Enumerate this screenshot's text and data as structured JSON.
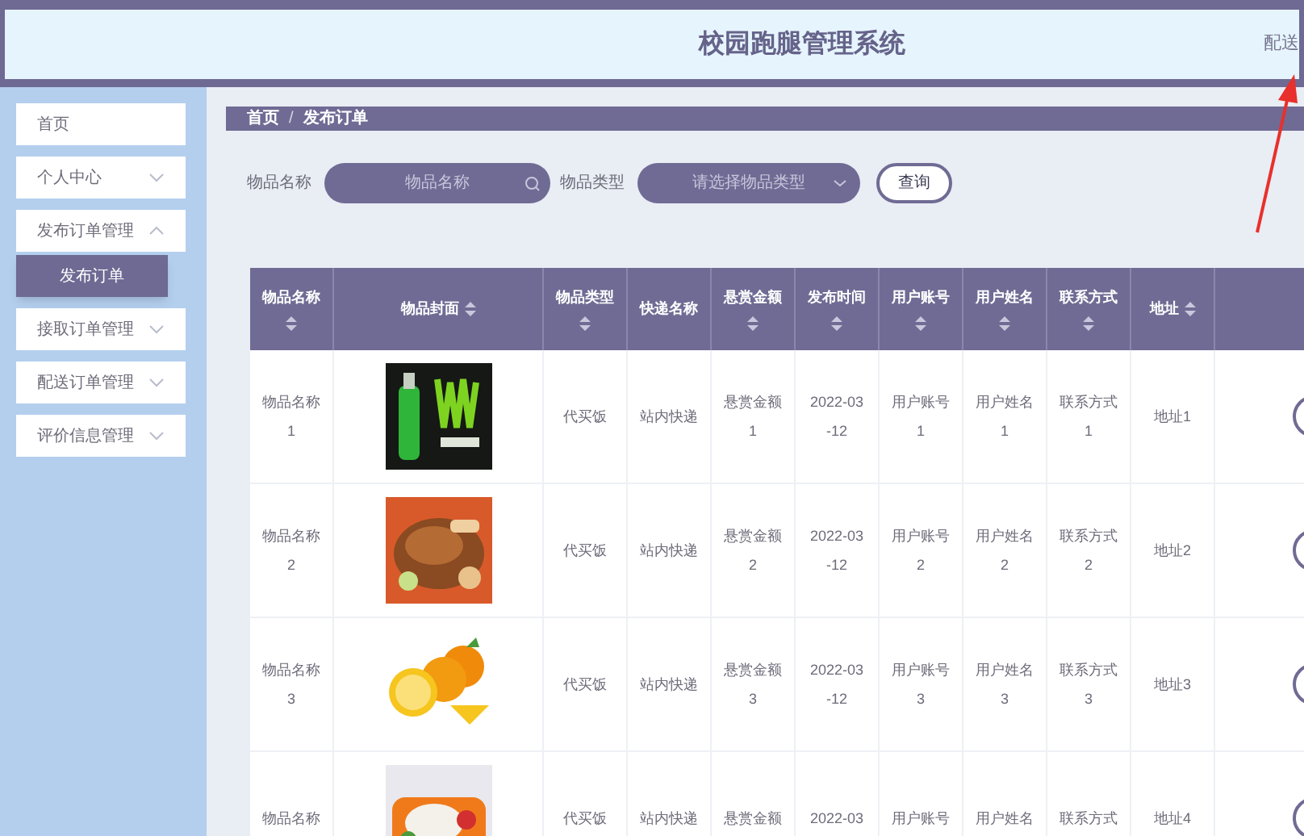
{
  "header": {
    "title": "校园跑腿管理系统",
    "user": "配送"
  },
  "sidebar": {
    "items": [
      {
        "label": "首页",
        "kind": "link"
      },
      {
        "label": "个人中心",
        "kind": "menu",
        "expanded": false
      },
      {
        "label": "发布订单管理",
        "kind": "menu",
        "expanded": true,
        "children": [
          {
            "label": "发布订单",
            "selected": true
          }
        ]
      },
      {
        "label": "接取订单管理",
        "kind": "menu",
        "expanded": false
      },
      {
        "label": "配送订单管理",
        "kind": "menu",
        "expanded": false
      },
      {
        "label": "评价信息管理",
        "kind": "menu",
        "expanded": false
      }
    ]
  },
  "breadcrumb": {
    "items": [
      "首页",
      "发布订单"
    ],
    "separator": "/"
  },
  "search": {
    "name_label": "物品名称",
    "name_placeholder": "物品名称",
    "type_label": "物品类型",
    "type_placeholder": "请选择物品类型",
    "button": "查询"
  },
  "table": {
    "columns": [
      {
        "label": "物品名称",
        "sortable": true
      },
      {
        "label": "物品封面",
        "sortable": true
      },
      {
        "label": "物品类型",
        "sortable": true
      },
      {
        "label": "快递名称",
        "sortable": false
      },
      {
        "label": "悬赏金额",
        "sortable": true
      },
      {
        "label": "发布时间",
        "sortable": true
      },
      {
        "label": "用户账号",
        "sortable": true
      },
      {
        "label": "用户姓名",
        "sortable": true
      },
      {
        "label": "联系方式",
        "sortable": true
      },
      {
        "label": "地址",
        "sortable": true
      }
    ],
    "rows": [
      {
        "cells": [
          [
            "物品名称",
            "1"
          ],
          null,
          [
            "代买饭"
          ],
          [
            "站内快递"
          ],
          [
            "悬赏金额",
            "1"
          ],
          [
            "2022-03",
            "-12"
          ],
          [
            "用户账号",
            "1"
          ],
          [
            "用户姓名",
            "1"
          ],
          [
            "联系方式",
            "1"
          ],
          [
            "地址1"
          ]
        ]
      },
      {
        "cells": [
          [
            "物品名称",
            "2"
          ],
          null,
          [
            "代买饭"
          ],
          [
            "站内快递"
          ],
          [
            "悬赏金额",
            "2"
          ],
          [
            "2022-03",
            "-12"
          ],
          [
            "用户账号",
            "2"
          ],
          [
            "用户姓名",
            "2"
          ],
          [
            "联系方式",
            "2"
          ],
          [
            "地址2"
          ]
        ]
      },
      {
        "cells": [
          [
            "物品名称",
            "3"
          ],
          null,
          [
            "代买饭"
          ],
          [
            "站内快递"
          ],
          [
            "悬赏金额",
            "3"
          ],
          [
            "2022-03",
            "-12"
          ],
          [
            "用户账号",
            "3"
          ],
          [
            "用户姓名",
            "3"
          ],
          [
            "联系方式",
            "3"
          ],
          [
            "地址3"
          ]
        ]
      },
      {
        "cells": [
          [
            "物品名称"
          ],
          null,
          [
            "代买饭"
          ],
          [
            "站内快递"
          ],
          [
            "悬赏金额"
          ],
          [
            "2022-03"
          ],
          [
            "用户账号"
          ],
          [
            "用户姓名"
          ],
          [
            "联系方式"
          ],
          [
            "地址4"
          ]
        ]
      }
    ]
  }
}
